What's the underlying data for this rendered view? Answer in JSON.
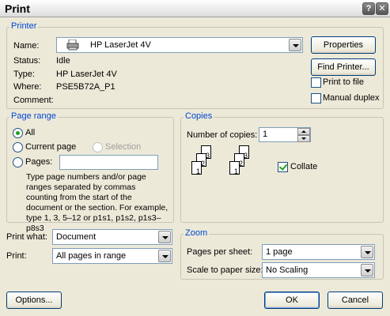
{
  "window": {
    "title": "Print",
    "help_glyph": "?",
    "close_glyph": "✕"
  },
  "printer": {
    "legend": "Printer",
    "name_label": "Name:",
    "name_value": "HP LaserJet 4V",
    "status_label": "Status:",
    "status_value": "Idle",
    "type_label": "Type:",
    "type_value": "HP LaserJet 4V",
    "where_label": "Where:",
    "where_value": "PSE5B72A_P1",
    "comment_label": "Comment:",
    "comment_value": "",
    "properties_label": "Properties",
    "find_printer_label": "Find Printer...",
    "print_to_file_label": "Print to file",
    "manual_duplex_label": "Manual duplex",
    "icon": "printer-icon"
  },
  "page_range": {
    "legend": "Page range",
    "all_label": "All",
    "current_label": "Current page",
    "selection_label": "Selection",
    "pages_label": "Pages:",
    "pages_value": "",
    "help_text": "Type page numbers and/or page ranges separated by commas counting from the start of the document or the section. For example, type 1, 3, 5–12 or p1s1, p1s2, p1s3–p8s3",
    "selected": "all"
  },
  "copies": {
    "legend": "Copies",
    "number_label": "Number of copies:",
    "number_value": "1",
    "collate_label": "Collate",
    "collate_checked": true,
    "stack_pages": [
      "1",
      "2",
      "3"
    ]
  },
  "print_what": {
    "label": "Print what:",
    "value": "Document"
  },
  "print": {
    "label": "Print:",
    "value": "All pages in range"
  },
  "zoom": {
    "legend": "Zoom",
    "pages_per_sheet_label": "Pages per sheet:",
    "pages_per_sheet_value": "1 page",
    "scale_label": "Scale to paper size:",
    "scale_value": "No Scaling"
  },
  "footer": {
    "options_label": "Options...",
    "ok_label": "OK",
    "cancel_label": "Cancel"
  },
  "colors": {
    "legend": "#0046d5",
    "check": "#21a121",
    "face": "#ece9d8"
  }
}
